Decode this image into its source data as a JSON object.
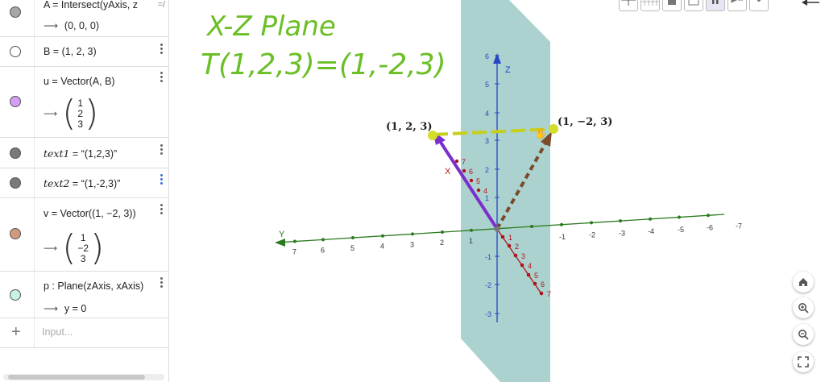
{
  "algebra": {
    "rows": [
      {
        "name": "A",
        "definition": "A = Intersect(yAxis, z",
        "output": "(0, 0, 0)",
        "marble_color": "#a6a6a6"
      },
      {
        "name": "B",
        "definition": "B = (1, 2, 3)",
        "marble_color": "#ffffff"
      },
      {
        "name": "u",
        "definition": "u = Vector(A, B)",
        "vector": [
          "1",
          "2",
          "3"
        ],
        "marble_color": "#d49ef5"
      },
      {
        "name": "text1",
        "label": "text1",
        "rest": " = “(1,2,3)”",
        "marble_color": "#7a7a7a"
      },
      {
        "name": "text2",
        "label": "text2",
        "rest": " = “(1,-2,3)”",
        "marble_color": "#7a7a7a"
      },
      {
        "name": "v",
        "definition": "v = Vector((1, −2, 3))",
        "vector": [
          "1",
          "−2",
          "3"
        ],
        "marble_color": "#d19a7e"
      },
      {
        "name": "p",
        "definition": "p : Plane(zAxis, xAxis)",
        "output": "y = 0",
        "marble_color": "#c8f2e6"
      }
    ],
    "input_placeholder": "Input..."
  },
  "graphics": {
    "handwriting": {
      "line1": "X-Z Plane",
      "line2": "T(1,2,3)=(1,-2,3)"
    },
    "labels": {
      "B": "(1, 2, 3)",
      "B_prime": "(1, −2, 3)"
    },
    "axes": {
      "x": "X",
      "y": "Y",
      "z": "Z"
    },
    "z_ticks": [
      "6",
      "5",
      "4",
      "3",
      "2",
      "1",
      "-1",
      "-2",
      "-3"
    ],
    "y_pos_ticks": [
      "7",
      "6",
      "5",
      "4",
      "3",
      "2",
      "1"
    ],
    "y_neg_ticks": [
      "-1",
      "-2",
      "-3",
      "-4",
      "-5",
      "-6",
      "-7"
    ],
    "x_ticks": [
      "1",
      "2",
      "3",
      "4",
      "5",
      "6",
      "7"
    ],
    "x_up_ticks": [
      "7",
      "6",
      "5",
      "4"
    ],
    "colors": {
      "plane": "#8fc3bd",
      "vector_u": "#7a2ecc",
      "vector_v": "#7a4a2a",
      "segment": "#c6cf1e",
      "y_axis": "#2b7a1f",
      "z_axis": "#2545c9",
      "x_axis": "#b2131a",
      "handwriting": "#6bbf26"
    }
  }
}
